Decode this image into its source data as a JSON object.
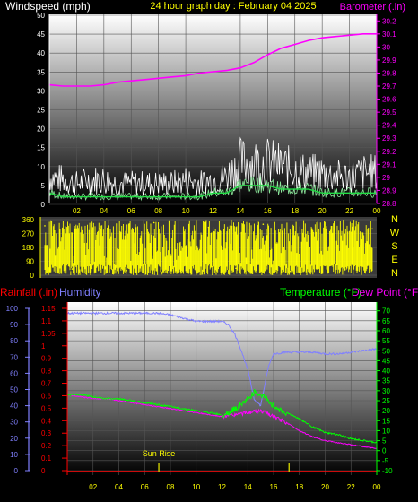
{
  "chart_data": [
    {
      "type": "line",
      "title": "24 hour graph day : February 04 2025",
      "ylabel_left": "Windspeed (mph)",
      "ylabel_right": "Barometer (.in)",
      "x_ticks": [
        "02",
        "04",
        "06",
        "08",
        "10",
        "12",
        "14",
        "16",
        "18",
        "20",
        "22",
        "00"
      ],
      "y_left_ticks": [
        "0",
        "5",
        "10",
        "15",
        "20",
        "25",
        "30",
        "35",
        "40",
        "45",
        "50"
      ],
      "y_left_range": [
        0,
        50
      ],
      "y_right_ticks": [
        "28.8",
        "28.9",
        "29",
        "29.1",
        "29.2",
        "29.3",
        "29.4",
        "29.5",
        "29.6",
        "29.7",
        "29.8",
        "29.9",
        "30",
        "30.1",
        "30.2"
      ],
      "y_right_range": [
        28.8,
        30.25
      ],
      "series": [
        {
          "name": "Windspeed (mph)",
          "axis": "left",
          "color": "#ffffff",
          "x": [
            0,
            1,
            2,
            3,
            4,
            5,
            6,
            7,
            8,
            9,
            10,
            11,
            12,
            13,
            14,
            15,
            16,
            17,
            18,
            19,
            20,
            21,
            22,
            23,
            24
          ],
          "y": [
            8,
            7,
            6,
            7,
            7,
            6,
            6,
            6,
            6,
            6,
            7,
            6,
            7,
            8,
            12,
            12,
            12,
            11,
            10,
            9,
            9,
            8,
            8,
            9,
            9
          ]
        },
        {
          "name": "Wind average",
          "axis": "left",
          "color": "#22dd44",
          "x": [
            0,
            1,
            2,
            3,
            4,
            5,
            6,
            7,
            8,
            9,
            10,
            11,
            12,
            13,
            14,
            15,
            16,
            17,
            18,
            19,
            20,
            21,
            22,
            23,
            24
          ],
          "y": [
            3,
            2,
            2,
            2,
            2,
            2,
            2,
            2,
            2,
            2,
            2,
            2,
            3,
            3,
            5,
            5,
            5,
            4,
            4,
            4,
            3,
            3,
            3,
            3,
            3
          ]
        },
        {
          "name": "Barometer (.in)",
          "axis": "right",
          "color": "#ff00ff",
          "x": [
            0,
            1,
            2,
            3,
            4,
            5,
            6,
            7,
            8,
            9,
            10,
            11,
            12,
            13,
            14,
            15,
            16,
            17,
            18,
            19,
            20,
            21,
            22,
            23,
            24
          ],
          "y": [
            29.71,
            29.7,
            29.7,
            29.7,
            29.71,
            29.73,
            29.74,
            29.75,
            29.76,
            29.77,
            29.78,
            29.8,
            29.81,
            29.82,
            29.84,
            29.88,
            29.94,
            29.99,
            30.02,
            30.05,
            30.07,
            30.08,
            30.09,
            30.1,
            30.1
          ]
        }
      ]
    },
    {
      "type": "scatter",
      "title": "",
      "ylabel_right": "N W S E N",
      "right_letters": [
        "N",
        "W",
        "S",
        "E",
        "N"
      ],
      "x_ticks": [],
      "y_ticks": [
        "360",
        "270",
        "180",
        "90",
        "0"
      ],
      "y_range": [
        0,
        360
      ],
      "series": [
        {
          "name": "Wind direction",
          "color": "#ffff00",
          "x": [
            0,
            2,
            4,
            6,
            8,
            10,
            12,
            14,
            16,
            18,
            20,
            22,
            24
          ],
          "y": [
            320,
            40,
            300,
            30,
            340,
            20,
            310,
            45,
            330,
            25,
            350,
            35,
            300
          ]
        }
      ]
    },
    {
      "type": "line",
      "title": "",
      "ylabel_rain": "Rainfall (.in)",
      "ylabel_humidity": "Humidity",
      "ylabel_temperature": "Temperature (°F)",
      "ylabel_dewpoint": "Dew Point (°F)",
      "x_ticks": [
        "02",
        "04",
        "06",
        "08",
        "10",
        "12",
        "14",
        "16",
        "18",
        "20",
        "22",
        "00"
      ],
      "humidity_ticks": [
        "0",
        "10",
        "20",
        "30",
        "40",
        "50",
        "60",
        "70",
        "80",
        "90",
        "100"
      ],
      "humidity_range": [
        0,
        100
      ],
      "rain_ticks": [
        "0",
        "0.1",
        "0.2",
        "0.3",
        "0.4",
        "0.5",
        "0.6",
        "0.7",
        "0.8",
        "0.9",
        "1",
        "1.05",
        "1.1",
        "1.15"
      ],
      "temp_ticks": [
        "-10",
        "-5",
        "0",
        "5",
        "10",
        "15",
        "20",
        "25",
        "30",
        "35",
        "40",
        "45",
        "50",
        "55",
        "60",
        "65",
        "70"
      ],
      "temp_range": [
        -10,
        73
      ],
      "annotations": [
        {
          "text": "Sun Rise",
          "x": 7.1
        },
        {
          "text": "",
          "x": 17.2
        }
      ],
      "series": [
        {
          "name": "Humidity",
          "axis": "humidity",
          "color": "#8080ff",
          "x": [
            0,
            1,
            2,
            3,
            4,
            5,
            6,
            7,
            8,
            9,
            10,
            11,
            12,
            12.5,
            13,
            13.5,
            14,
            14.5,
            15,
            15.3,
            15.6,
            16,
            17,
            18,
            19,
            20,
            21,
            22,
            23,
            24
          ],
          "y": [
            97,
            97,
            97,
            97,
            97,
            97,
            97,
            97,
            96,
            94,
            92,
            92,
            92,
            90,
            84,
            74,
            62,
            44,
            40,
            52,
            64,
            72,
            73,
            73,
            73,
            72,
            72,
            73,
            74,
            75
          ]
        },
        {
          "name": "Temperature (°F)",
          "axis": "temp",
          "color": "#00ff00",
          "x": [
            0,
            1,
            2,
            3,
            4,
            5,
            6,
            7,
            8,
            9,
            10,
            11,
            12,
            12.5,
            13,
            13.5,
            14,
            14.5,
            15,
            15.5,
            16,
            17,
            18,
            19,
            20,
            21,
            22,
            23,
            24
          ],
          "y": [
            28,
            28,
            27,
            26,
            26,
            25,
            24,
            23,
            22,
            21,
            20,
            19,
            18,
            19,
            21,
            23,
            26,
            29,
            28,
            26,
            22,
            19,
            16,
            12,
            9,
            8,
            6,
            5,
            4
          ]
        },
        {
          "name": "Dew Point (°F)",
          "axis": "temp",
          "color": "#ff00ff",
          "x": [
            0,
            1,
            2,
            3,
            4,
            5,
            6,
            7,
            8,
            9,
            10,
            11,
            12,
            13,
            14,
            15,
            16,
            17,
            18,
            19,
            20,
            21,
            22,
            23,
            24
          ],
          "y": [
            28,
            27,
            26,
            26,
            25,
            24,
            23,
            22,
            21,
            20,
            19,
            18,
            17,
            18,
            19,
            20,
            17,
            14,
            10,
            7,
            5,
            4,
            3,
            2,
            1
          ]
        },
        {
          "name": "Rainfall (.in)",
          "axis": "rain",
          "color": "#ff0000",
          "x": [
            0,
            24
          ],
          "y": [
            0,
            0
          ]
        }
      ]
    }
  ],
  "colors": {
    "windspeed_axis": "#ffffff",
    "barometer_axis": "#ff00ff",
    "title": "#ffff00",
    "direction_axis": "#ffff00",
    "rain_axis": "#ff0000",
    "humidity_axis": "#8080ff",
    "temperature_axis": "#00ff00"
  }
}
